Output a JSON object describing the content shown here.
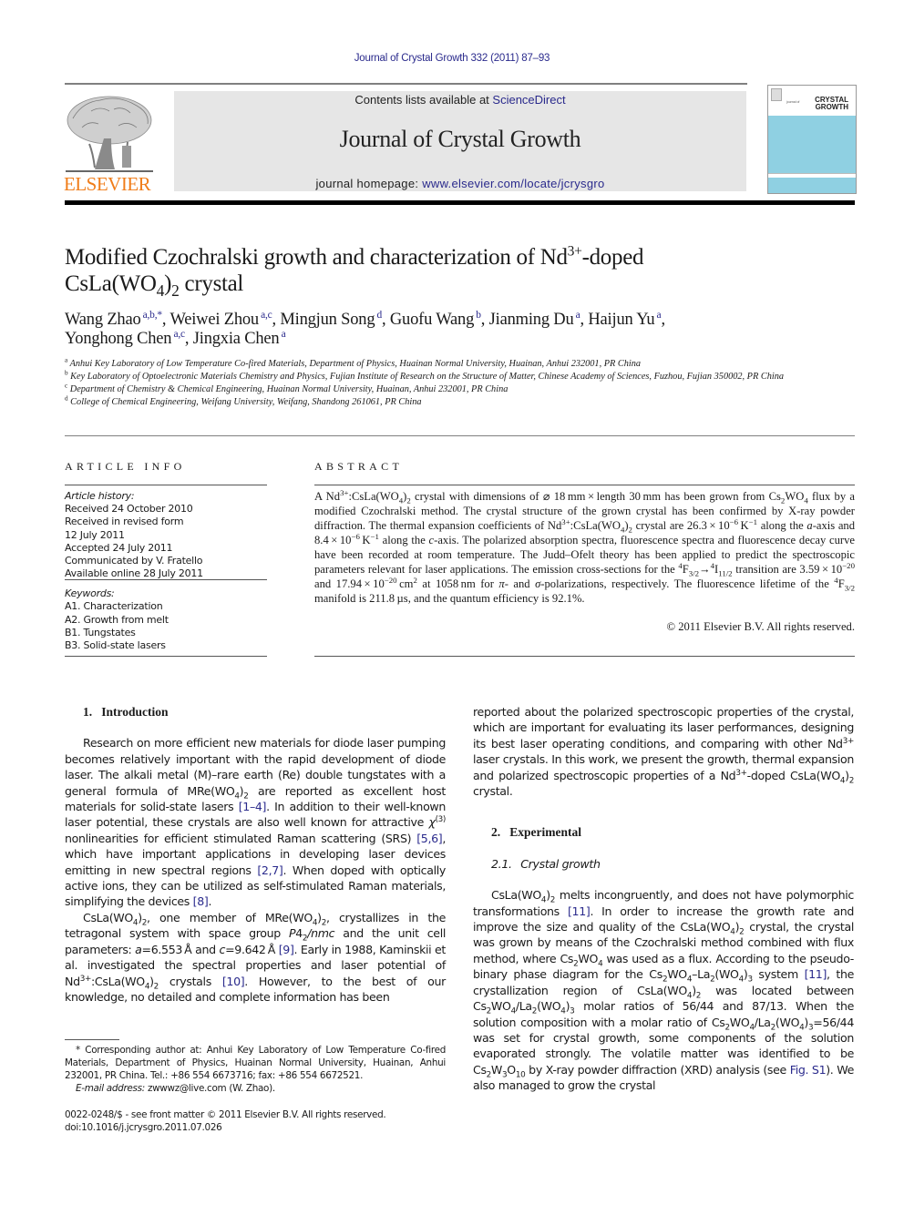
{
  "header": {
    "running_head": "Journal of Crystal Growth 332 (2011) 87–93",
    "contents_prefix": "Contents lists available at ",
    "contents_link": "ScienceDirect",
    "journal_title": "Journal of Crystal Growth",
    "homepage_prefix": "journal homepage: ",
    "homepage_link": "www.elsevier.com/locate/jcrysgro",
    "publisher_logo_text": "ELSEVIER",
    "publisher_logo_icon": "elsevier-tree-icon",
    "cover": {
      "small_text": "journal of",
      "title_line1": "CRYSTAL",
      "title_line2": "GROWTH"
    },
    "colors": {
      "link": "#2a2a8c",
      "elsevier_orange": "#f07d1a",
      "banner_bg": "#e6e6e6",
      "cover_band": "#8fd0e2"
    }
  },
  "article": {
    "title": [
      {
        "t": "Modified Czochralski growth and characterization of Nd"
      },
      {
        "t": "3+",
        "sup": true
      },
      {
        "t": "-doped"
      },
      {
        "br": true
      },
      {
        "t": "CsLa(WO"
      },
      {
        "t": "4",
        "sub": true
      },
      {
        "t": ")"
      },
      {
        "t": "2",
        "sub": true
      },
      {
        "t": " crystal"
      }
    ],
    "authors": [
      {
        "name": "Wang Zhao",
        "aff": "a,b,*"
      },
      {
        "name": "Weiwei Zhou",
        "aff": "a,c"
      },
      {
        "name": "Mingjun Song",
        "aff": "d"
      },
      {
        "name": "Guofu Wang",
        "aff": "b"
      },
      {
        "name": "Jianming Du",
        "aff": "a"
      },
      {
        "name": "Haijun Yu",
        "aff": "a"
      },
      {
        "name": "Yonghong Chen",
        "aff": "a,c"
      },
      {
        "name": "Jingxia Chen",
        "aff": "a"
      }
    ],
    "affiliations": [
      {
        "key": "a",
        "text": "Anhui Key Laboratory of Low Temperature Co-fired Materials, Department of Physics, Huainan Normal University, Huainan, Anhui 232001, PR China"
      },
      {
        "key": "b",
        "text": "Key Laboratory of Optoelectronic Materials Chemistry and Physics, Fujian Institute of Research on the Structure of Matter, Chinese Academy of Sciences, Fuzhou, Fujian 350002, PR China"
      },
      {
        "key": "c",
        "text": "Department of Chemistry & Chemical Engineering, Huainan Normal University, Huainan, Anhui 232001, PR China"
      },
      {
        "key": "d",
        "text": "College of Chemical Engineering, Weifang University, Weifang, Shandong 261061, PR China"
      }
    ]
  },
  "article_info": {
    "heading": "ARTICLE INFO",
    "history_label": "Article history:",
    "history": [
      "Received 24 October 2010",
      "Received in revised form",
      "12 July 2011",
      "Accepted 24 July 2011",
      "Communicated by V. Fratello",
      "Available online 28 July 2011"
    ],
    "keywords_label": "Keywords:",
    "keywords": [
      "A1. Characterization",
      "A2. Growth from melt",
      "B1. Tungstates",
      "B3. Solid-state lasers"
    ]
  },
  "abstract": {
    "heading": "ABSTRACT",
    "text": [
      {
        "t": "A Nd"
      },
      {
        "t": "3+",
        "sup": true
      },
      {
        "t": ":CsLa(WO"
      },
      {
        "t": "4",
        "sub": true
      },
      {
        "t": ")"
      },
      {
        "t": "2",
        "sub": true
      },
      {
        "t": " crystal with dimensions of ⌀ 18 mm × length 30 mm has been grown from Cs"
      },
      {
        "t": "2",
        "sub": true
      },
      {
        "t": "WO"
      },
      {
        "t": "4",
        "sub": true
      },
      {
        "t": " flux by a modified Czochralski method. The crystal structure of the grown crystal has been confirmed by X-ray powder diffraction. The thermal expansion coefficients of Nd"
      },
      {
        "t": "3+",
        "sup": true
      },
      {
        "t": ":CsLa(WO"
      },
      {
        "t": "4",
        "sub": true
      },
      {
        "t": ")"
      },
      {
        "t": "2",
        "sub": true
      },
      {
        "t": " crystal are 26.3 × 10"
      },
      {
        "t": "−6",
        "sup": true
      },
      {
        "t": " K"
      },
      {
        "t": "−1",
        "sup": true
      },
      {
        "t": " along the "
      },
      {
        "t": "a",
        "i": true
      },
      {
        "t": "-axis and 8.4 × 10"
      },
      {
        "t": "−6",
        "sup": true
      },
      {
        "t": " K"
      },
      {
        "t": "−1",
        "sup": true
      },
      {
        "t": " along the "
      },
      {
        "t": "c",
        "i": true
      },
      {
        "t": "-axis. The polarized absorption spectra, fluorescence spectra and fluorescence decay curve have been recorded at room temperature. The Judd–Ofelt theory has been applied to predict the spectroscopic parameters relevant for laser applications. The emission cross-sections for the "
      },
      {
        "t": "4",
        "sup": true
      },
      {
        "t": "F"
      },
      {
        "t": "3/2",
        "sub": true
      },
      {
        "t": "→"
      },
      {
        "t": "4",
        "sup": true
      },
      {
        "t": "I"
      },
      {
        "t": "11/2",
        "sub": true
      },
      {
        "t": " transition are 3.59 × 10"
      },
      {
        "t": "−20",
        "sup": true
      },
      {
        "t": " and 17.94 × 10"
      },
      {
        "t": "−20",
        "sup": true
      },
      {
        "t": " cm"
      },
      {
        "t": "2",
        "sup": true
      },
      {
        "t": " at 1058 nm for "
      },
      {
        "t": "π",
        "i": true
      },
      {
        "t": "- and "
      },
      {
        "t": "σ",
        "i": true
      },
      {
        "t": "-polarizations, respectively. The fluorescence lifetime of the "
      },
      {
        "t": "4",
        "sup": true
      },
      {
        "t": "F"
      },
      {
        "t": "3/2",
        "sub": true
      },
      {
        "t": " manifold is 211.8 µs, and the quantum efficiency is 92.1%."
      }
    ],
    "copyright": "© 2011 Elsevier B.V. All rights reserved."
  },
  "body": {
    "left": [
      {
        "type": "h",
        "text": "1.  Introduction"
      },
      {
        "type": "gap"
      },
      {
        "type": "p",
        "segs": [
          {
            "t": "Research on more efficient new materials for diode laser pumping becomes relatively important with the rapid development of diode laser. The alkali metal (M)–rare earth (Re) double tungstates with a general formula of MRe(WO"
          },
          {
            "t": "4",
            "sub": true
          },
          {
            "t": ")"
          },
          {
            "t": "2",
            "sub": true
          },
          {
            "t": " are reported as excellent host materials for solid-state lasers "
          },
          {
            "t": "[1–4]",
            "link": true
          },
          {
            "t": ". In addition to their well-known laser potential, these crystals are also well known for attractive "
          },
          {
            "t": "χ",
            "i": true
          },
          {
            "t": "(3)",
            "sup": true
          },
          {
            "t": " nonlinearities for efficient stimulated Raman scattering (SRS) "
          },
          {
            "t": "[5,6]",
            "link": true
          },
          {
            "t": ", which have important applications in developing laser devices emitting in new spectral regions "
          },
          {
            "t": "[2,7]",
            "link": true
          },
          {
            "t": ". When doped with optically active ions, they can be utilized as self-stimulated Raman materials, simplifying the devices "
          },
          {
            "t": "[8]",
            "link": true
          },
          {
            "t": "."
          }
        ]
      },
      {
        "type": "p",
        "segs": [
          {
            "t": "CsLa(WO"
          },
          {
            "t": "4",
            "sub": true
          },
          {
            "t": ")"
          },
          {
            "t": "2",
            "sub": true
          },
          {
            "t": ", one member of MRe(WO"
          },
          {
            "t": "4",
            "sub": true
          },
          {
            "t": ")"
          },
          {
            "t": "2",
            "sub": true
          },
          {
            "t": ", crystallizes in the tetragonal system with space group "
          },
          {
            "t": "P",
            "i": true
          },
          {
            "t": "4"
          },
          {
            "t": "2",
            "sub": true
          },
          {
            "t": "/",
            "i": true
          },
          {
            "t": "nmc",
            "i": true
          },
          {
            "t": " and the unit cell parameters: "
          },
          {
            "t": "a",
            "i": true
          },
          {
            "t": "=6.553 Å and "
          },
          {
            "t": "c",
            "i": true
          },
          {
            "t": "=9.642 Å "
          },
          {
            "t": "[9]",
            "link": true
          },
          {
            "t": ". Early in 1988, Kaminskii et al. investigated the spectral properties and laser potential of Nd"
          },
          {
            "t": "3+",
            "sup": true
          },
          {
            "t": ":CsLa(WO"
          },
          {
            "t": "4",
            "sub": true
          },
          {
            "t": ")"
          },
          {
            "t": "2",
            "sub": true
          },
          {
            "t": " crystals "
          },
          {
            "t": "[10]",
            "link": true
          },
          {
            "t": ". However, to the best of our knowledge, no detailed and complete information has been"
          }
        ]
      }
    ],
    "right": [
      {
        "type": "pn",
        "segs": [
          {
            "t": "reported about the polarized spectroscopic properties of the crystal, which are important for evaluating its laser performances, designing its best laser operating conditions, and comparing with other Nd"
          },
          {
            "t": "3+",
            "sup": true
          },
          {
            "t": " laser crystals. In this work, we present the growth, thermal expansion and polarized spectroscopic properties of a Nd"
          },
          {
            "t": "3+",
            "sup": true
          },
          {
            "t": "-doped CsLa(WO"
          },
          {
            "t": "4",
            "sub": true
          },
          {
            "t": ")"
          },
          {
            "t": "2",
            "sub": true
          },
          {
            "t": " crystal."
          }
        ]
      },
      {
        "type": "gap2"
      },
      {
        "type": "h",
        "text": "2.  Experimental"
      },
      {
        "type": "gap"
      },
      {
        "type": "sh",
        "text": "2.1.  Crystal growth"
      },
      {
        "type": "gap"
      },
      {
        "type": "p",
        "segs": [
          {
            "t": "CsLa(WO"
          },
          {
            "t": "4",
            "sub": true
          },
          {
            "t": ")"
          },
          {
            "t": "2",
            "sub": true
          },
          {
            "t": " melts incongruently, and does not have polymorphic transformations "
          },
          {
            "t": "[11]",
            "link": true
          },
          {
            "t": ". In order to increase the growth rate and improve the size and quality of the CsLa(WO"
          },
          {
            "t": "4",
            "sub": true
          },
          {
            "t": ")"
          },
          {
            "t": "2",
            "sub": true
          },
          {
            "t": " crystal, the crystal was grown by means of the Czochralski method combined with flux method, where Cs"
          },
          {
            "t": "2",
            "sub": true
          },
          {
            "t": "WO"
          },
          {
            "t": "4",
            "sub": true
          },
          {
            "t": " was used as a flux. According to the pseudo-binary phase diagram for the Cs"
          },
          {
            "t": "2",
            "sub": true
          },
          {
            "t": "WO"
          },
          {
            "t": "4",
            "sub": true
          },
          {
            "t": "–La"
          },
          {
            "t": "2",
            "sub": true
          },
          {
            "t": "(WO"
          },
          {
            "t": "4",
            "sub": true
          },
          {
            "t": ")"
          },
          {
            "t": "3",
            "sub": true
          },
          {
            "t": " system "
          },
          {
            "t": "[11]",
            "link": true
          },
          {
            "t": ", the crystallization region of CsLa(WO"
          },
          {
            "t": "4",
            "sub": true
          },
          {
            "t": ")"
          },
          {
            "t": "2",
            "sub": true
          },
          {
            "t": " was located between Cs"
          },
          {
            "t": "2",
            "sub": true
          },
          {
            "t": "WO"
          },
          {
            "t": "4",
            "sub": true
          },
          {
            "t": "/La"
          },
          {
            "t": "2",
            "sub": true
          },
          {
            "t": "(WO"
          },
          {
            "t": "4",
            "sub": true
          },
          {
            "t": ")"
          },
          {
            "t": "3",
            "sub": true
          },
          {
            "t": " molar ratios of 56/44 and 87/13. When the solution composition with a molar ratio of Cs"
          },
          {
            "t": "2",
            "sub": true
          },
          {
            "t": "WO"
          },
          {
            "t": "4",
            "sub": true
          },
          {
            "t": "/La"
          },
          {
            "t": "2",
            "sub": true
          },
          {
            "t": "(WO"
          },
          {
            "t": "4",
            "sub": true
          },
          {
            "t": ")"
          },
          {
            "t": "3",
            "sub": true
          },
          {
            "t": "=56/44 was set for crystal growth, some components of the solution evaporated strongly. The volatile matter was identified to be Cs"
          },
          {
            "t": "2",
            "sub": true
          },
          {
            "t": "W"
          },
          {
            "t": "3",
            "sub": true
          },
          {
            "t": "O"
          },
          {
            "t": "10",
            "sub": true
          },
          {
            "t": " by X-ray powder diffraction (XRD) analysis (see "
          },
          {
            "t": "Fig. S1",
            "link": true
          },
          {
            "t": "). We also managed to grow the crystal"
          }
        ]
      }
    ]
  },
  "footnotes": {
    "corresponding": "* Corresponding author at: Anhui Key Laboratory of Low Temperature Co-fired Materials, Department of Physics, Huainan Normal University, Huainan, Anhui 232001, PR China. Tel.: +86 554 6673716; fax: +86 554 6672521.",
    "email_label": "E-mail address:",
    "email": " zwwwz@live.com (W. Zhao).",
    "issn_line": "0022-0248/$ - see front matter © 2011 Elsevier B.V. All rights reserved.",
    "doi_line": "doi:10.1016/j.jcrysgro.2011.07.026"
  }
}
